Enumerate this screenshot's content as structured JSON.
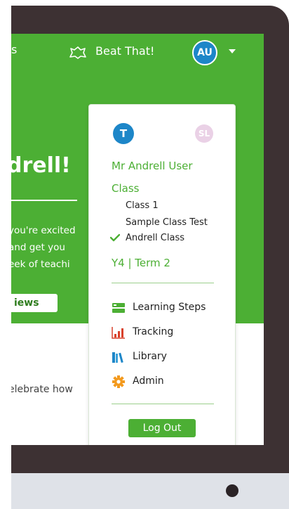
{
  "topbar": {
    "edge_text": "s",
    "app_label": "Beat That!",
    "user_initials": "AU"
  },
  "hero": {
    "title": "drell!",
    "lines": [
      "you're excited",
      " and get you",
      "eek of teachi"
    ],
    "news_button": "iews"
  },
  "body": {
    "line": "elebrate how"
  },
  "dropdown": {
    "avatar_primary": "T",
    "avatar_secondary": "SL",
    "user_name": "Mr Andrell User",
    "class_heading": "Class",
    "classes": [
      {
        "label": "Class 1",
        "selected": false
      },
      {
        "label": "Sample Class Test",
        "selected": false
      },
      {
        "label": "Andrell Class",
        "selected": true
      }
    ],
    "year_term": "Y4  |  Term 2",
    "menu": [
      {
        "label": "Learning Steps",
        "icon": "learning-steps-icon"
      },
      {
        "label": "Tracking",
        "icon": "tracking-chart-icon"
      },
      {
        "label": "Library",
        "icon": "library-books-icon"
      },
      {
        "label": "Admin",
        "icon": "gear-icon"
      }
    ],
    "logout_label": "Log Out"
  },
  "colors": {
    "brand_green": "#4caf34",
    "avatar_blue": "#1d86c8",
    "avatar_pink": "#ead1e6",
    "tracking_red": "#d9412b",
    "admin_orange": "#f39a1e",
    "bezel": "#3d3133"
  }
}
